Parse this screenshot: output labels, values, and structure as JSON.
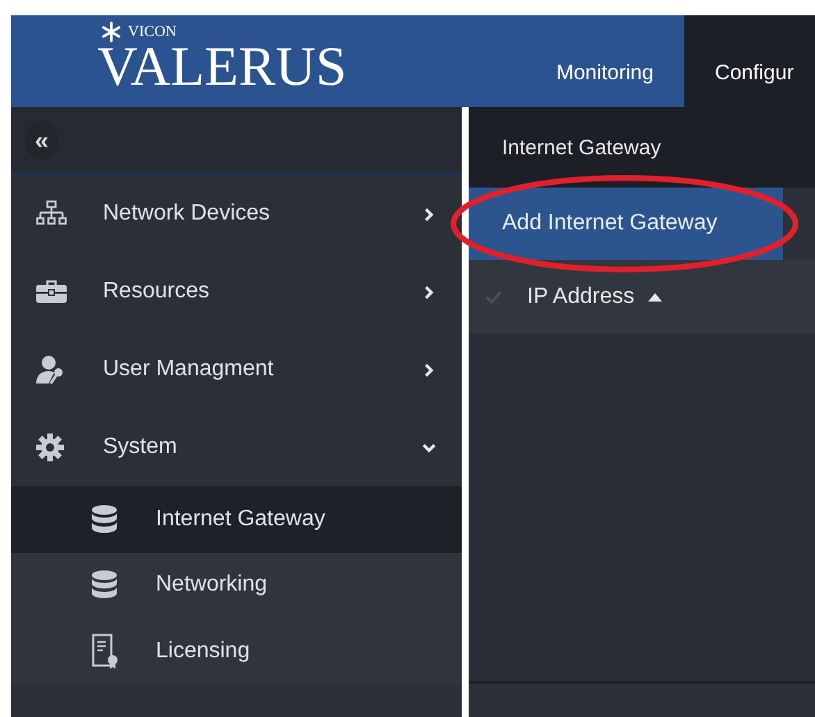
{
  "brand": {
    "company": "VICON",
    "product": "VALERUS"
  },
  "tabs": [
    {
      "label": "Monitoring",
      "selected": false
    },
    {
      "label": "Configur",
      "selected": true
    }
  ],
  "sidebar": {
    "collapse": "«",
    "items": [
      {
        "label": "Network Devices",
        "expanded": false
      },
      {
        "label": "Resources",
        "expanded": false
      },
      {
        "label": "User Managment",
        "expanded": false
      },
      {
        "label": "System",
        "expanded": true,
        "children": [
          {
            "label": "Internet Gateway",
            "selected": true
          },
          {
            "label": "Networking",
            "selected": false
          },
          {
            "label": "Licensing",
            "selected": false
          }
        ]
      }
    ]
  },
  "content": {
    "title": "Internet Gateway",
    "add_button": "Add Internet Gateway",
    "highlighted": true,
    "table": {
      "columns": [
        {
          "label": "IP Address",
          "sorted": true
        }
      ]
    }
  }
}
